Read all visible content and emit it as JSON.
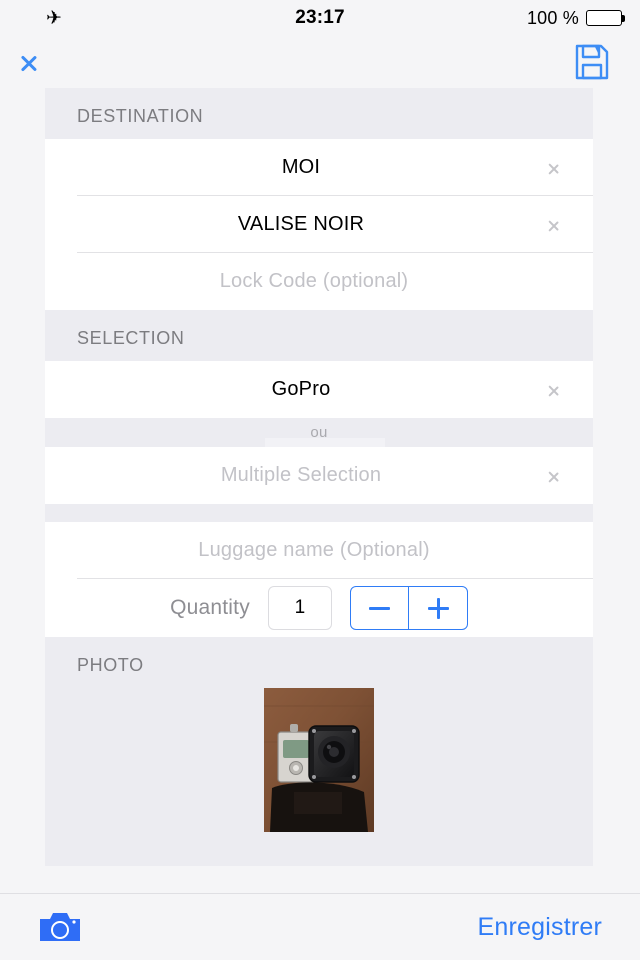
{
  "status_bar": {
    "airplane_icon": "airplane-icon",
    "time": "23:17",
    "battery_percent": "100 %",
    "battery_level": 100
  },
  "nav_bar": {
    "back_icon": "chevron-left-icon",
    "save_icon": "floppy-disk-icon"
  },
  "sections": {
    "destination": {
      "header": "DESTINATION",
      "rows": [
        {
          "label": "MOI",
          "has_chevron": true,
          "placeholder": false
        },
        {
          "label": "VALISE NOIR",
          "has_chevron": true,
          "placeholder": false
        },
        {
          "label": "Lock Code (optional)",
          "has_chevron": false,
          "placeholder": true
        }
      ]
    },
    "selection": {
      "header": "SELECTION",
      "item_row": {
        "label": "GoPro",
        "has_chevron": true,
        "placeholder": false
      },
      "divider_label": "ou",
      "multiple_row": {
        "label": "Multiple Selection",
        "has_chevron": true,
        "placeholder": true
      },
      "luggage_name": {
        "label": "Luggage name (Optional)",
        "placeholder": true
      },
      "quantity": {
        "label": "Quantity",
        "value": "1",
        "minus": "minus-icon",
        "plus": "plus-icon"
      }
    },
    "photo": {
      "header": "PHOTO",
      "thumbnail_alt": "gopro-camera-photo"
    }
  },
  "toolbar": {
    "camera_icon": "camera-icon",
    "save_label": "Enregistrer"
  },
  "colors": {
    "accent_blue": "#2f7cf6",
    "nav_blue": "#3d8df5",
    "page_bg": "#f5f5f7",
    "section_bg": "#ececf1",
    "cell_bg": "#ffffff",
    "placeholder_grey": "#c2c2c7",
    "header_grey": "#7c7c80"
  }
}
